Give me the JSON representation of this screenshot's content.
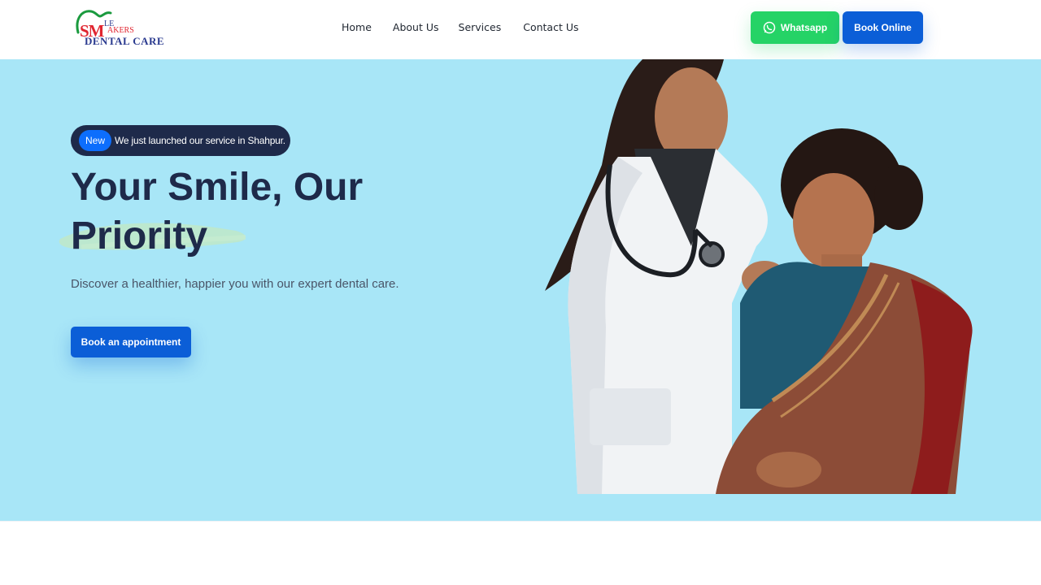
{
  "brand": {
    "logo_sm": "SM",
    "logo_le": "LE",
    "logo_akers": "AKERS",
    "logo_subtitle": "DENTAL CARE"
  },
  "nav": {
    "items": [
      "Home",
      "About Us",
      "Services",
      "Contact Us"
    ]
  },
  "header_actions": {
    "whatsapp_label": "Whatsapp",
    "book_online_label": "Book Online"
  },
  "hero": {
    "badge_pill": "New",
    "badge_text": "We just launched our service in Shahpur.",
    "headline_line1": "Your Smile, Our",
    "headline_line2": "Priority",
    "subtitle": "Discover a healthier, happier you with our expert dental care.",
    "cta_label": "Book an appointment"
  },
  "colors": {
    "hero_bg": "#a8e6f7",
    "primary": "#0b5ed7",
    "whatsapp": "#25d366",
    "navy": "#1e2a4a"
  }
}
